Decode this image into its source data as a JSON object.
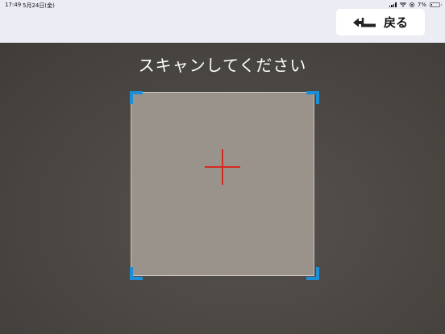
{
  "status_bar": {
    "time": "17:49",
    "date": "5月24日(金)",
    "battery_percent_label": "7%",
    "battery_level": 0.07
  },
  "header": {
    "back_label": "戻る",
    "back_icon": "return-arrow-icon"
  },
  "scanner": {
    "instruction": "スキャンしてください",
    "crosshair_icon": "crosshair-icon",
    "corner_color": "#1c8fd6",
    "crosshair_color": "#d42a1f"
  },
  "colors": {
    "topbar_bg": "#ececf4",
    "camera_bg": "#4a4642",
    "scan_frame_bg": "#9a938c"
  }
}
